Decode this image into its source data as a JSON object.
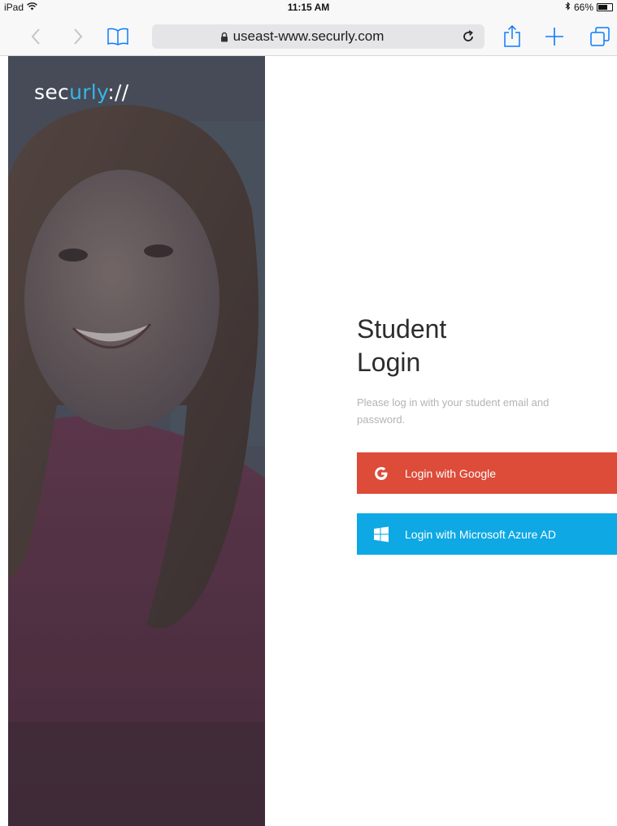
{
  "status_bar": {
    "device": "iPad",
    "time": "11:15 AM",
    "battery_percent": "66%",
    "battery_level": 0.66
  },
  "browser": {
    "url": "useast-www.securly.com"
  },
  "brand": {
    "logo_main": "sec",
    "logo_accent": "urly",
    "logo_suffix": "://",
    "accent_color": "#35b7e8"
  },
  "login": {
    "heading_line1": "Student",
    "heading_line2": "Login",
    "subtext": "Please log in with your student email and password.",
    "google_button_label": "Login with Google",
    "azure_button_label": "Login with Microsoft Azure AD",
    "google_color": "#dd4b39",
    "azure_color": "#0ea8e4"
  }
}
